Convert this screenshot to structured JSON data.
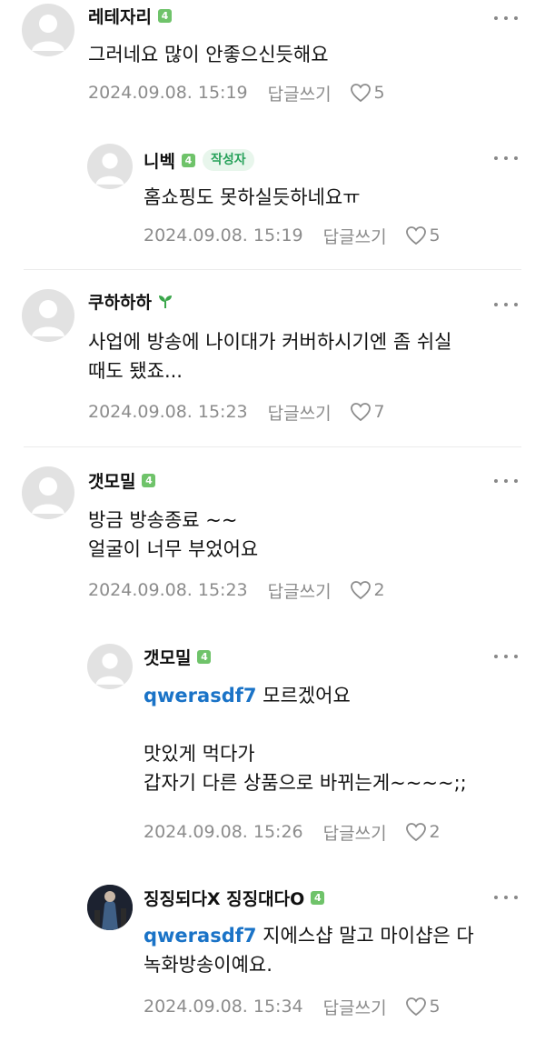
{
  "comments": [
    {
      "author": "레테자리",
      "badge": "4",
      "text": "그러네요 많이 안좋으신듯해요",
      "date": "2024.09.08. 15:19",
      "reply": "답글쓰기",
      "likes": "5"
    },
    {
      "author": "니벡",
      "badge": "4",
      "author_tag": "작성자",
      "text": "홈쇼핑도 못하실듯하네요ㅠ",
      "date": "2024.09.08. 15:19",
      "reply": "답글쓰기",
      "likes": "5"
    },
    {
      "author": "쿠하하하",
      "icon": "sprout-icon",
      "text": "사업에 방송에 나이대가 커버하시기엔 좀 쉬실\n때도 됐죠...",
      "date": "2024.09.08. 15:23",
      "reply": "답글쓰기",
      "likes": "7"
    },
    {
      "author": "갯모밀",
      "badge": "4",
      "text": "방금 방송종료 ~~\n얼굴이 너무 부었어요",
      "date": "2024.09.08. 15:23",
      "reply": "답글쓰기",
      "likes": "2"
    },
    {
      "author": "갯모밀",
      "badge": "4",
      "mention": "qwerasdf7",
      "text": " 모르겠어요\n\n맛있게 먹다가\n갑자기 다른 상품으로 바뀌는게~~~~;;",
      "date": "2024.09.08. 15:26",
      "reply": "답글쓰기",
      "likes": "2"
    },
    {
      "author": "징징되다X 징징대다O",
      "badge": "4",
      "mention": "qwerasdf7",
      "text": " 지에스샵 말고 마이샵은 다\n녹화방송이예요.",
      "date": "2024.09.08. 15:34",
      "reply": "답글쓰기",
      "likes": "5"
    }
  ],
  "colors": {
    "mention": "#1a73c7",
    "level_badge": "#6fc36a",
    "author_tag_bg": "#e8f6ec",
    "author_tag_text": "#27a15a",
    "meta": "#8c8c8c"
  }
}
